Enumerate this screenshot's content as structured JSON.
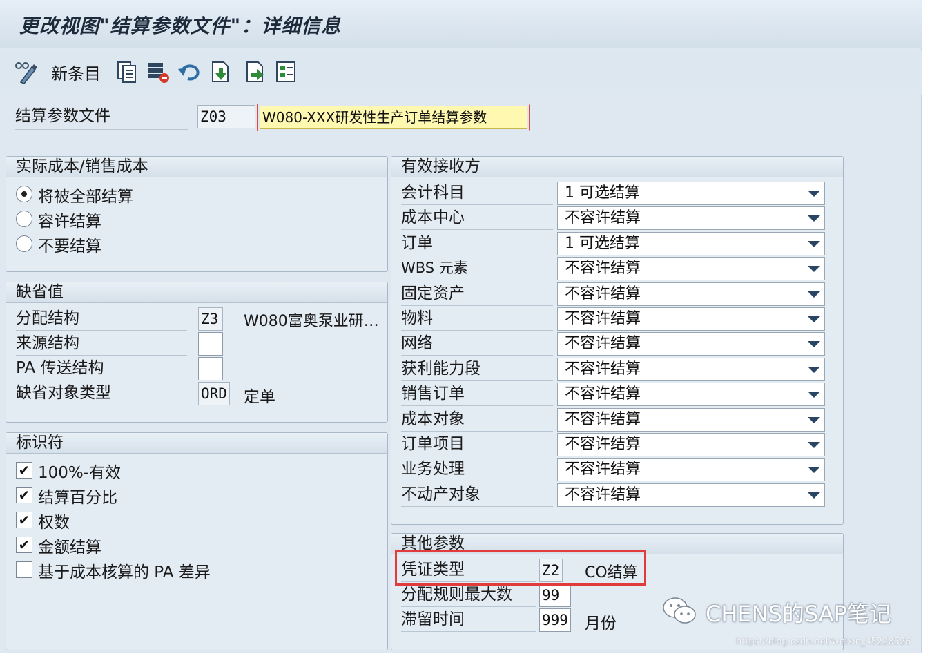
{
  "title": "更改视图\"结算参数文件\"：详细信息",
  "toolbar": {
    "new_entry_label": "新条目"
  },
  "header": {
    "profile_label": "结算参数文件",
    "profile_code": "Z03",
    "profile_desc": "W080-XXX研发性生产订单结算参数"
  },
  "actual_cost": {
    "title": "实际成本/销售成本",
    "options": [
      "将被全部结算",
      "容许结算",
      "不要结算"
    ],
    "selected_index": 0
  },
  "defaults": {
    "title": "缺省值",
    "rows": [
      {
        "label": "分配结构",
        "value": "Z3",
        "desc": "W080富奥泵业研…"
      },
      {
        "label": "来源结构",
        "value": "",
        "desc": ""
      },
      {
        "label": "PA 传送结构",
        "value": "",
        "desc": ""
      },
      {
        "label": "缺省对象类型",
        "value": "ORD",
        "desc": "定单"
      }
    ]
  },
  "indicators": {
    "title": "标识符",
    "items": [
      {
        "label": "100%-有效",
        "checked": true
      },
      {
        "label": "结算百分比",
        "checked": true
      },
      {
        "label": "权数",
        "checked": true
      },
      {
        "label": "金额结算",
        "checked": true
      },
      {
        "label": "基于成本核算的 PA 差异",
        "checked": false
      }
    ]
  },
  "receivers": {
    "title": "有效接收方",
    "rows": [
      {
        "label": "会计科目",
        "value": "1 可选结算"
      },
      {
        "label": "成本中心",
        "value": "不容许结算"
      },
      {
        "label": "订单",
        "value": "1 可选结算"
      },
      {
        "label": "WBS 元素",
        "value": "不容许结算"
      },
      {
        "label": "固定资产",
        "value": "不容许结算"
      },
      {
        "label": "物料",
        "value": "不容许结算"
      },
      {
        "label": "网络",
        "value": "不容许结算"
      },
      {
        "label": "获利能力段",
        "value": "不容许结算"
      },
      {
        "label": "销售订单",
        "value": "不容许结算"
      },
      {
        "label": "成本对象",
        "value": "不容许结算"
      },
      {
        "label": "订单项目",
        "value": "不容许结算"
      },
      {
        "label": "业务处理",
        "value": "不容许结算"
      },
      {
        "label": "不动产对象",
        "value": "不容许结算"
      }
    ]
  },
  "other": {
    "title": "其他参数",
    "rows": [
      {
        "label": "凭证类型",
        "value": "Z2",
        "desc": "CO结算"
      },
      {
        "label": "分配规则最大数",
        "value": "99",
        "desc": ""
      },
      {
        "label": "滞留时间",
        "value": "999",
        "desc": "月份"
      }
    ]
  },
  "watermark": {
    "text": "CHENS的SAP笔记",
    "url": "https://blog.csdn.net/weixin_45228526"
  },
  "colors": {
    "highlight_red": "#e23b3b",
    "required_yellow": "#fff8b0",
    "frame_blue": "#dfe8f1"
  }
}
